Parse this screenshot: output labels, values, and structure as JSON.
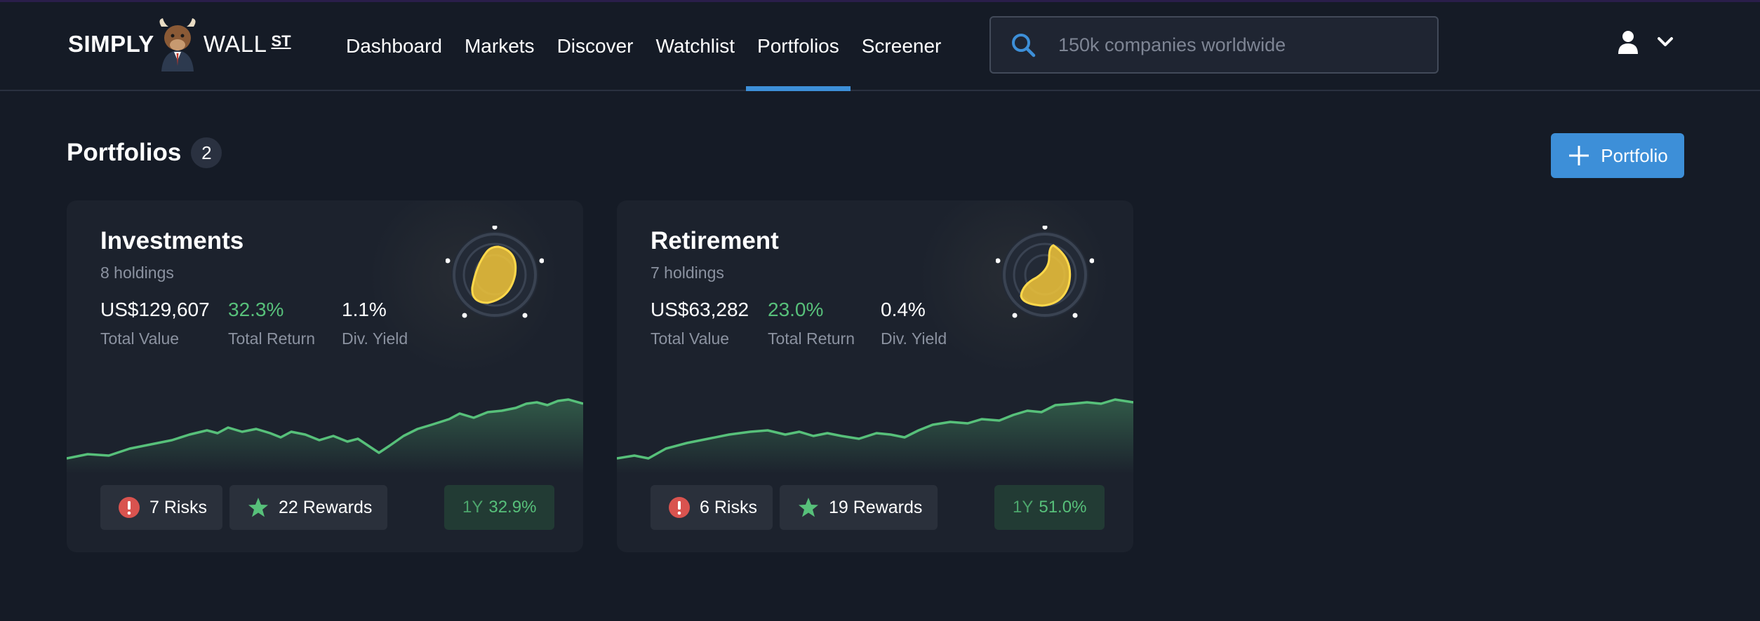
{
  "brand": {
    "word1": "SIMPLY",
    "word2": "WALL",
    "word3": "ST"
  },
  "nav": {
    "items": [
      {
        "label": "Dashboard",
        "active": false
      },
      {
        "label": "Markets",
        "active": false
      },
      {
        "label": "Discover",
        "active": false
      },
      {
        "label": "Watchlist",
        "active": false
      },
      {
        "label": "Portfolios",
        "active": true
      },
      {
        "label": "Screener",
        "active": false
      }
    ]
  },
  "search": {
    "placeholder": "150k companies worldwide",
    "value": ""
  },
  "icons": {
    "search": "search-icon",
    "user": "user-icon",
    "chevron": "chevron-down-icon",
    "plus": "plus-icon",
    "risk": "exclamation-circle-icon",
    "reward": "star-icon"
  },
  "page": {
    "title": "Portfolios",
    "count": "2",
    "add_button": "Portfolio"
  },
  "colors": {
    "accent": "#3d8fd8",
    "positive": "#57c07a",
    "risk": "#d9534f",
    "snowflake": "#f2c63a"
  },
  "portfolios": [
    {
      "name": "Investments",
      "holdings": "8 holdings",
      "total_value": "US$129,607",
      "total_value_label": "Total Value",
      "total_return": "32.3%",
      "total_return_label": "Total Return",
      "div_yield": "1.1%",
      "div_yield_label": "Div. Yield",
      "risks": "7 Risks",
      "rewards": "22 Rewards",
      "period": "1Y",
      "period_return": "32.9%"
    },
    {
      "name": "Retirement",
      "holdings": "7 holdings",
      "total_value": "US$63,282",
      "total_value_label": "Total Value",
      "total_return": "23.0%",
      "total_return_label": "Total Return",
      "div_yield": "0.4%",
      "div_yield_label": "Div. Yield",
      "risks": "6 Risks",
      "rewards": "19 Rewards",
      "period": "1Y",
      "period_return": "51.0%"
    }
  ]
}
